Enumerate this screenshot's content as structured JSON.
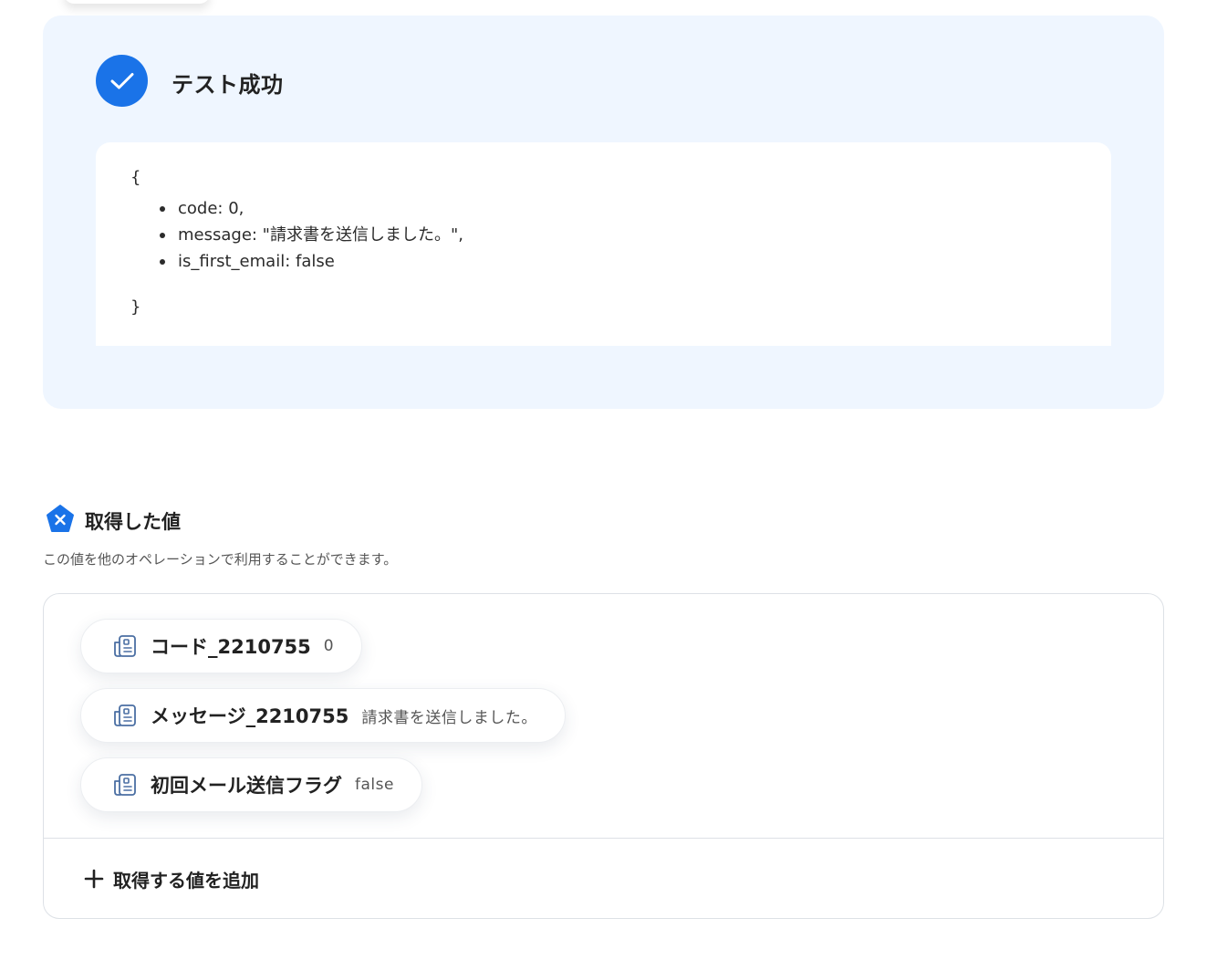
{
  "success": {
    "title": "テスト成功",
    "icon": "check-icon",
    "accent_color": "#1a73e8",
    "json_open": "{",
    "json_close": "}",
    "json_lines": [
      "code: 0,",
      "message: \"請求書を送信しました。\",",
      "is_first_email: false"
    ]
  },
  "acquired": {
    "icon": "yoom-pentagon-icon",
    "title": "取得した値",
    "description": "この値を他のオペレーションで利用することができます。",
    "items": [
      {
        "name": "コード_2210755",
        "value": "0",
        "icon": "data-field-icon"
      },
      {
        "name": "メッセージ_2210755",
        "value": "請求書を送信しました。",
        "icon": "data-field-icon"
      },
      {
        "name": "初回メール送信フラグ",
        "value": "false",
        "icon": "data-field-icon"
      }
    ],
    "add_label": "取得する値を追加"
  }
}
